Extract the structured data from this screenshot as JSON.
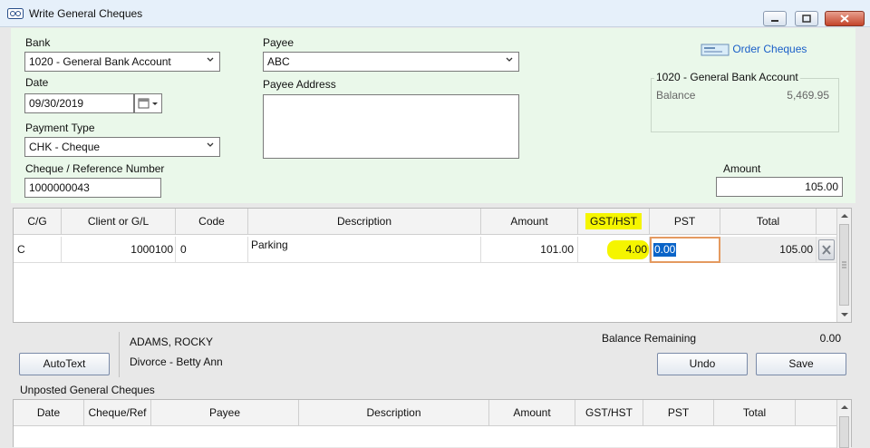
{
  "window": {
    "title": "Write General Cheques"
  },
  "form": {
    "bank_label": "Bank",
    "bank_value": "1020 - General Bank Account",
    "date_label": "Date",
    "date_value": "09/30/2019",
    "payment_type_label": "Payment Type",
    "payment_type_value": "CHK - Cheque",
    "cheque_ref_label": "Cheque / Reference Number",
    "cheque_ref_value": "1000000043",
    "payee_label": "Payee",
    "payee_value": "ABC",
    "payee_address_label": "Payee Address",
    "payee_address_value": "",
    "order_cheques": "Order Cheques",
    "account_box_title": "1020 - General Bank Account",
    "balance_label": "Balance",
    "balance_value": "5,469.95",
    "amount_label": "Amount",
    "amount_value": "105.00"
  },
  "entry_grid": {
    "columns": [
      "C/G",
      "Client or G/L",
      "Code",
      "Description",
      "Amount",
      "GST/HST",
      "PST",
      "Total"
    ],
    "row": {
      "cg": "C",
      "client": "1000100",
      "code": "0",
      "description": "Parking",
      "amount": "101.00",
      "gst": "4.00",
      "pst": "0.00",
      "total": "105.00"
    },
    "highlight_color": "#f5f500"
  },
  "details": {
    "autotext_button": "AutoText",
    "client_name": "ADAMS, ROCKY",
    "matter": "Divorce - Betty Ann",
    "balance_remaining_label": "Balance Remaining",
    "balance_remaining_value": "0.00",
    "undo_button": "Undo",
    "save_button": "Save"
  },
  "unposted": {
    "title": "Unposted General Cheques",
    "columns": [
      "Date",
      "Cheque/Ref",
      "Payee",
      "Description",
      "Amount",
      "GST/HST",
      "PST",
      "Total"
    ]
  },
  "icons": {
    "window": "cheque-window-icon",
    "calendar": "calendar-icon",
    "order": "order-cheques-icon",
    "delete": "delete-row-icon"
  }
}
